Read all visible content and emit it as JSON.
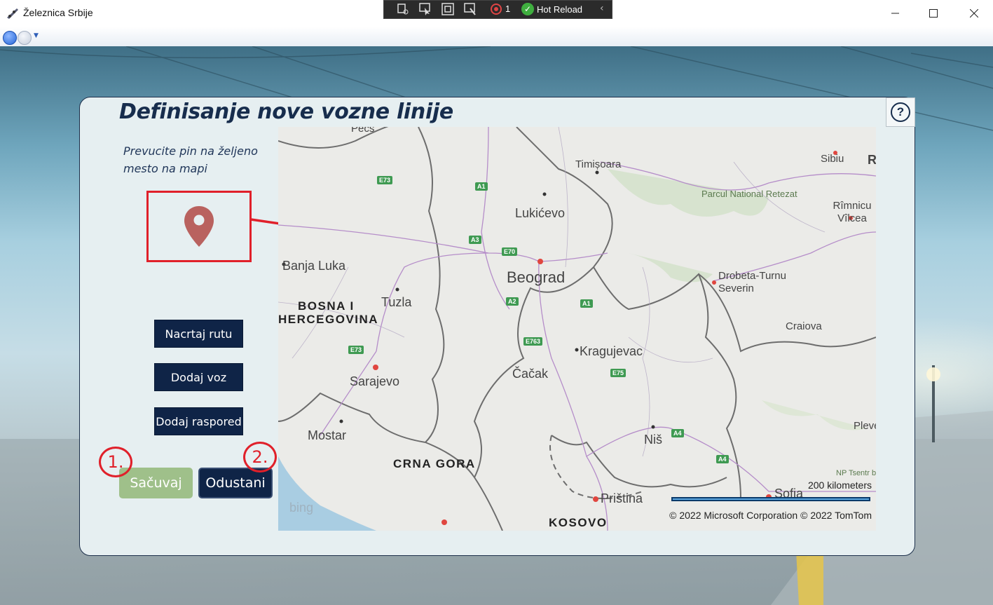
{
  "window": {
    "title": "Železnica Srbije",
    "minimize_icon": "minimize-icon",
    "maximize_icon": "maximize-icon",
    "close_icon": "close-icon"
  },
  "debug_toolbar": {
    "hot_reload_label": "Hot Reload",
    "exception_count": "1"
  },
  "dialog": {
    "title": "Definisanje nove vozne linije",
    "help_label": "?",
    "instruction": "Prevucite pin na željeno mesto na mapi",
    "buttons": {
      "draw_route": "Nacrtaj rutu",
      "add_train": "Dodaj voz",
      "add_schedule": "Dodaj raspored",
      "save": "Sačuvaj",
      "cancel": "Odustani"
    },
    "annotations": {
      "badge_1": "1.",
      "badge_2": "2."
    },
    "accent_colors": {
      "primary": "#0f2447",
      "save": "#9fc08a",
      "annotation": "#e0202a",
      "pin": "#b9625f"
    }
  },
  "map": {
    "cities": {
      "pecs": "Pecs",
      "timisoara": "Timișoara",
      "sibiu": "Sibiu",
      "r_cut": "R",
      "lukicevo": "Lukićevo",
      "parcul": "Parcul National Retezat",
      "rimnicu": "Rîmnicu Vîlcea",
      "banja_luka": "Banja Luka",
      "beograd": "Beograd",
      "drobeta": "Drobeta-Turnu Severin",
      "tuzla": "Tuzla",
      "craiova": "Craiova",
      "kragujevac": "Kragujevac",
      "sarajevo": "Sarajevo",
      "cacak": "Čačak",
      "mostar": "Mostar",
      "nis": "Niš",
      "pleven": "Pleve",
      "pristina": "Priština",
      "sofia": "Sofia",
      "balkan": "NP Tsentr balkan"
    },
    "regions": {
      "bih_1": "BOSNA I",
      "bih_2": "HERCEGOVINA",
      "crna_gora": "CRNA GORA",
      "kosovo": "KOSOVO"
    },
    "roads": [
      "E73",
      "A1",
      "A3",
      "E70",
      "A2",
      "A1",
      "E763",
      "E73",
      "E75",
      "A4",
      "A4"
    ],
    "scale_text": "200 kilometers",
    "copyright": "© 2022 Microsoft Corporation   © 2022 TomTom",
    "logo_text": "bing"
  }
}
